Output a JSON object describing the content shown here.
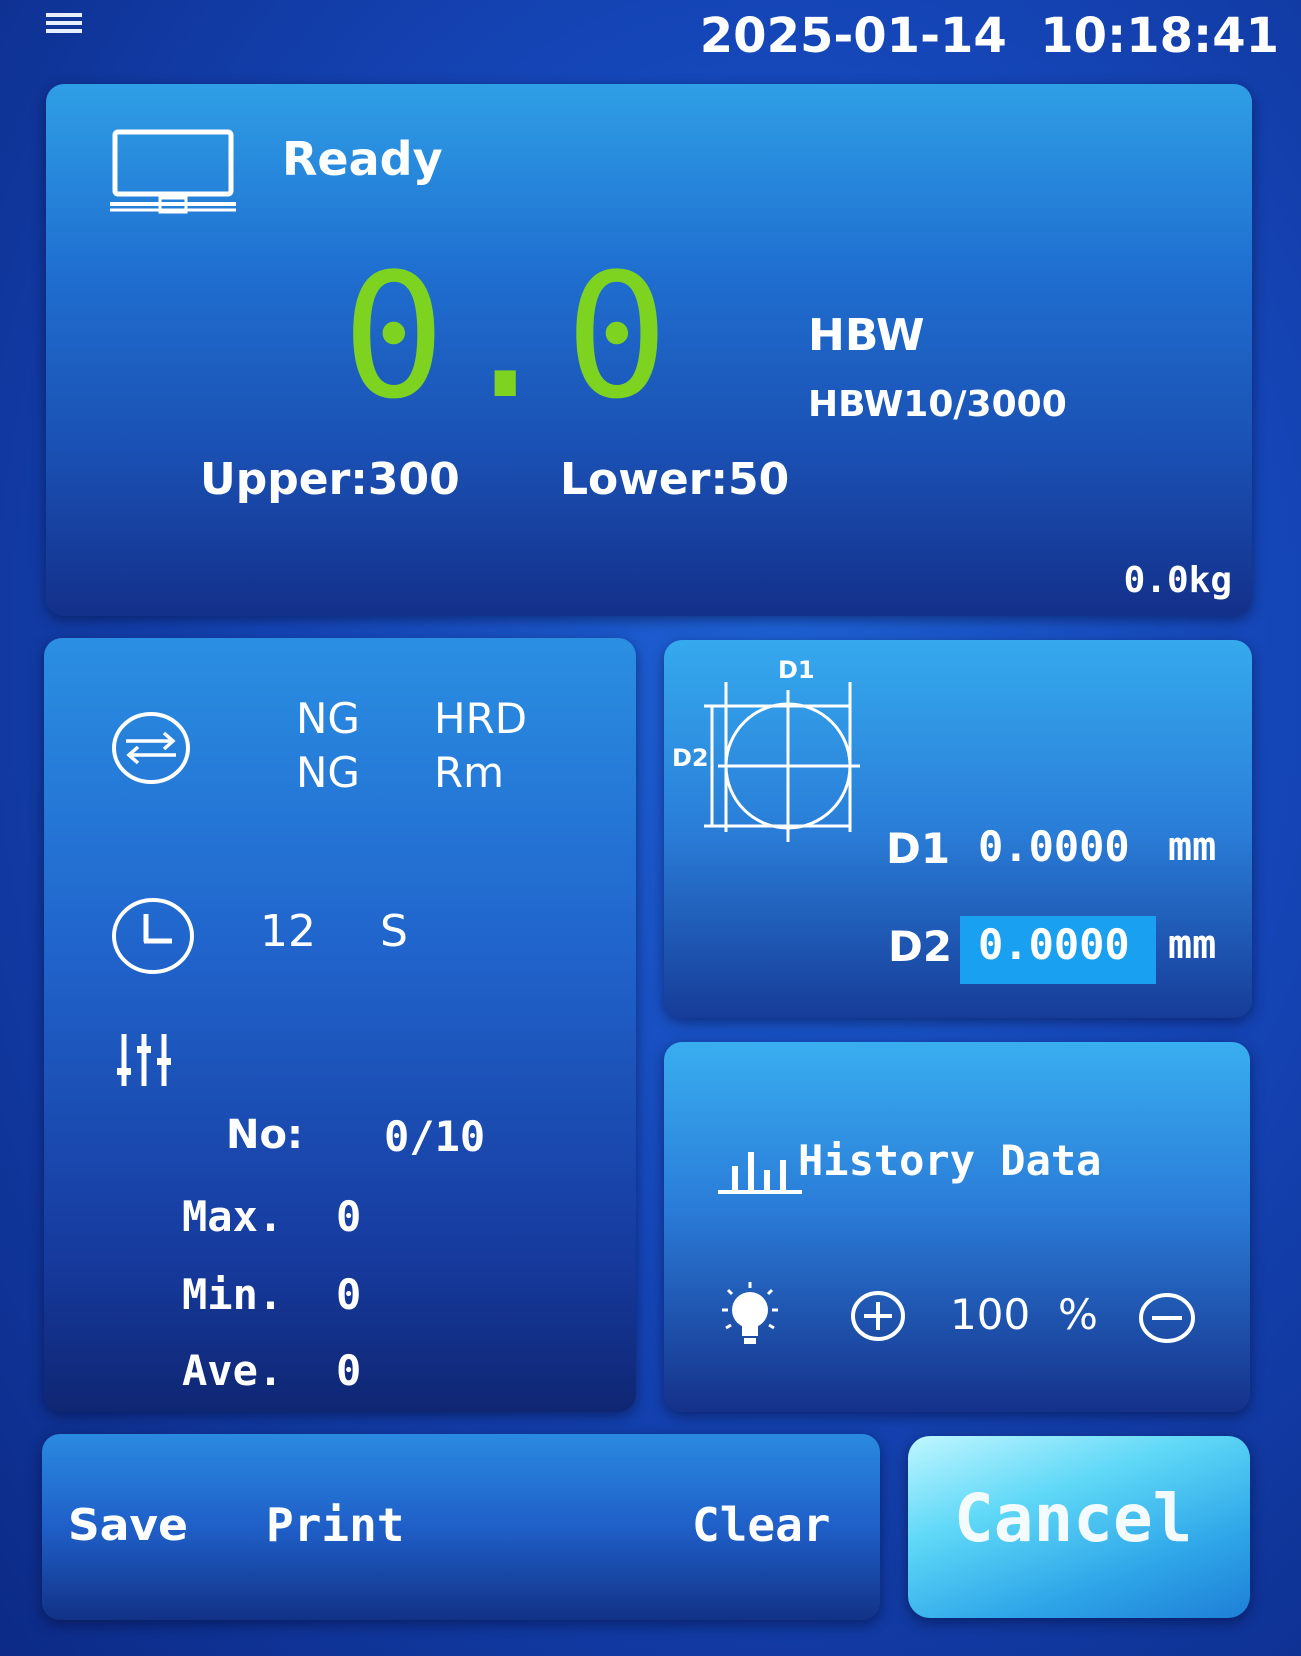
{
  "header": {
    "datetime": "2025-01-14  10:18:41",
    "menu_icon": "menu-icon"
  },
  "status": {
    "monitor_icon": "monitor-icon",
    "label": "Ready"
  },
  "reading": {
    "value": "0.0",
    "scale": "HBW",
    "method": "HBW10/3000",
    "upper": "Upper:300",
    "lower": "Lower:50",
    "load": "0.0kg",
    "value_color": "#7ed321"
  },
  "conversion": {
    "icon": "swap-icon",
    "row1_result": "NG",
    "row1_scale": "HRD",
    "row2_result": "NG",
    "row2_scale": "Rm"
  },
  "dwell": {
    "icon": "clock-icon",
    "value": "12",
    "unit": "S"
  },
  "stats": {
    "icon": "sliders-icon",
    "no_label": "No:",
    "no_value": "0/10",
    "max_label": "Max.",
    "max_value": "0",
    "min_label": "Min.",
    "min_value": "0",
    "ave_label": "Ave.",
    "ave_value": "0"
  },
  "diagonals": {
    "diagram_icon": "indentation-diagram",
    "diagram_d1": "D1",
    "diagram_d2": "D2",
    "d1_label": "D1",
    "d1_value": "0.0000",
    "d1_unit": "mm",
    "d2_label": "D2",
    "d2_value": "0.0000",
    "d2_unit": "mm",
    "active_color": "#1aa0f0"
  },
  "history": {
    "icon": "bar-chart-icon",
    "label": "History Data"
  },
  "brightness": {
    "icon": "bulb-icon",
    "plus_icon": "plus-circle-icon",
    "value": "100",
    "unit": "%",
    "minus_icon": "minus-circle-icon"
  },
  "actions": {
    "save": "Save",
    "print": "Print",
    "clear": "Clear",
    "cancel": "Cancel"
  }
}
